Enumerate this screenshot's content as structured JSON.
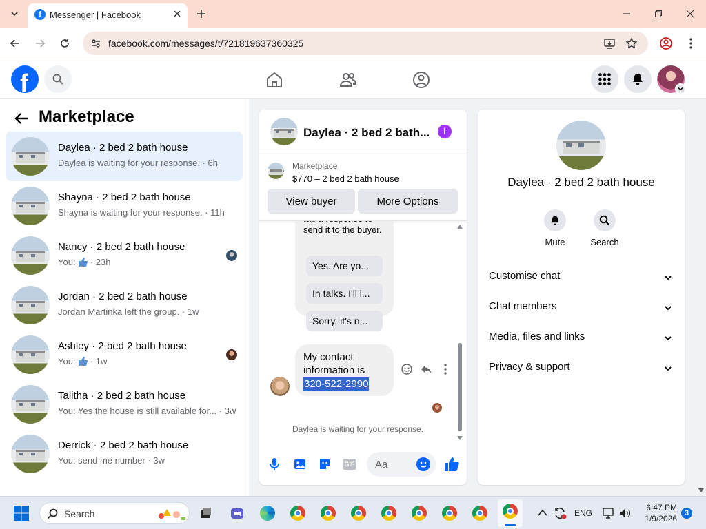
{
  "browser": {
    "tab_title": "Messenger | Facebook",
    "url": "facebook.com/messages/t/721819637360325"
  },
  "marketplace": {
    "heading": "Marketplace",
    "conversations": [
      {
        "title": "Daylea · 2 bed 2 bath house",
        "subtitle": "Daylea is waiting for your response. · 6h"
      },
      {
        "title": "Shayna · 2 bed 2 bath house",
        "subtitle": "Shayna is waiting for your response. · 11h"
      },
      {
        "title": "Nancy · 2 bed 2 bath house",
        "subtitle_prefix": "You:",
        "subtitle": "· 23h"
      },
      {
        "title": "Jordan · 2 bed 2 bath house",
        "subtitle": "Jordan Martinka left the group. · 1w"
      },
      {
        "title": "Ashley · 2 bed 2 bath house",
        "subtitle_prefix": "You:",
        "subtitle": "· 1w"
      },
      {
        "title": "Talitha · 2 bed 2 bath house",
        "subtitle": "You: Yes the house is still available for... · 3w"
      },
      {
        "title": "Derrick · 2 bed 2 bath house",
        "subtitle": "You: send me number · 3w"
      }
    ]
  },
  "chat": {
    "title": "Daylea · 2 bed 2 bath...",
    "listing_label": "Marketplace",
    "listing_price_title": "$770 – 2 bed 2 bath house",
    "view_buyer_label": "View buyer",
    "more_options_label": "More Options",
    "partial_text": "tap a response to send it to the buyer.",
    "quick_replies": [
      "Yes. Are yo...",
      "In talks. I'll l...",
      "Sorry, it's n..."
    ],
    "message_text": "My contact information is",
    "message_phone": "320-522-2990",
    "status_text": "Daylea is waiting for your response.",
    "composer_placeholder": "Aa"
  },
  "info": {
    "name": "Daylea · 2 bed 2 bath house",
    "mute_label": "Mute",
    "search_label": "Search",
    "sections": [
      "Customise chat",
      "Chat members",
      "Media, files and links",
      "Privacy & support"
    ]
  },
  "taskbar": {
    "search_placeholder": "Search",
    "language": "ENG",
    "time": "6:47 PM",
    "date": "1/9/2026",
    "notification_count": "3"
  },
  "colors": {
    "facebook_blue": "#0866ff",
    "tab_strip": "#fadcd0",
    "active_conversation": "#e7f0fd",
    "info_purple": "#a033ff"
  }
}
